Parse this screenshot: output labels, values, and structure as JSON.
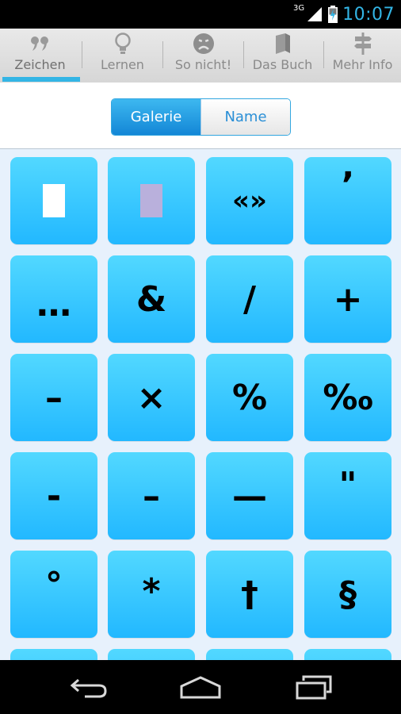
{
  "status_bar": {
    "network": "3G",
    "time": "10:07"
  },
  "tabs": [
    {
      "label": "Zeichen",
      "icon": "quote-icon",
      "active": true
    },
    {
      "label": "Lernen",
      "icon": "lightbulb-icon",
      "active": false
    },
    {
      "label": "So nicht!",
      "icon": "frown-face-icon",
      "active": false
    },
    {
      "label": "Das Buch",
      "icon": "book-icon",
      "active": false
    },
    {
      "label": "Mehr Info",
      "icon": "signpost-icon",
      "active": false
    }
  ],
  "view_toggle": {
    "gallery_label": "Galerie",
    "name_label": "Name",
    "selected": "Galerie"
  },
  "symbols": [
    [
      "white-block-symbol",
      "lavender-block-symbol",
      "«»",
      "’"
    ],
    [
      "…",
      "&",
      "/",
      "+"
    ],
    [
      "–",
      "×",
      "%",
      "‰"
    ],
    [
      "-",
      "–",
      "—",
      "\""
    ],
    [
      "°",
      "*",
      "†",
      "§"
    ],
    [
      "",
      "",
      "",
      ""
    ]
  ],
  "colors": {
    "accent": "#33b5e5",
    "tile_top": "#52d8ff",
    "tile_bottom": "#22b8ff",
    "grid_background": "#e7f1fc",
    "white_block": "#ffffff",
    "lavender_block": "#b9b0dc"
  },
  "nav_bar": [
    "back-icon",
    "home-icon",
    "recent-apps-icon"
  ]
}
